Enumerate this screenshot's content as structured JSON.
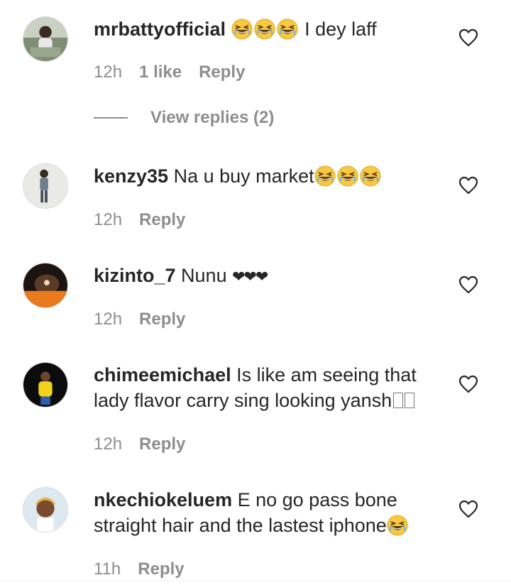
{
  "comments": [
    {
      "username": "mrbattyofficial",
      "text": "I dey laff",
      "time": "12h",
      "likes": "1 like",
      "reply": "Reply",
      "replies_label": "View replies (2)"
    },
    {
      "username": "kenzy35",
      "text": "Na u buy market",
      "time": "12h",
      "reply": "Reply"
    },
    {
      "username": "kizinto_7",
      "text": "Nunu",
      "hearts": "❤❤❤",
      "time": "12h",
      "reply": "Reply"
    },
    {
      "username": "chimeemichael",
      "text": "Is like am seeing that lady flavor carry sing looking yansh",
      "time": "12h",
      "reply": "Reply"
    },
    {
      "username": "nkechiokeluem",
      "text": "E no go pass bone straight hair and the lastest iphone",
      "time": "11h",
      "reply": "Reply"
    }
  ],
  "icons": {
    "like": "heart-outline-icon",
    "emoji": "grinning-squinting-face-emoji"
  },
  "colors": {
    "text": "#262626",
    "muted": "#8e8e8e",
    "emoji": "#f7c843"
  }
}
